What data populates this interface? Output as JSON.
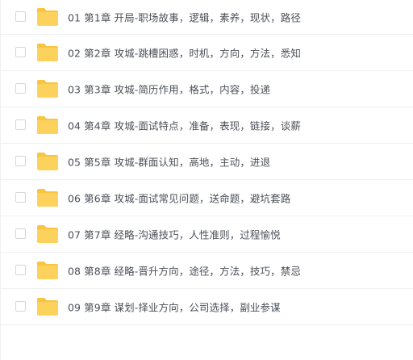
{
  "icons": {
    "folder": "folder-icon",
    "checkbox": "checkbox-unchecked",
    "folder_color": "#FDD25C",
    "folder_tab_color": "#F9C440"
  },
  "files": [
    {
      "name": "01 第1章 开局-职场故事，逻辑，素养，现状，路径"
    },
    {
      "name": "02 第2章 攻城-跳槽困惑，时机，方向，方法，悉知"
    },
    {
      "name": "03 第3章 攻城-简历作用，格式，内容，投递"
    },
    {
      "name": "04 第4章 攻城-面试特点，准备，表现，链接，谈薪"
    },
    {
      "name": "05 第5章 攻城-群面认知，高地，主动，进退"
    },
    {
      "name": "06 第6章 攻城-面试常见问题，送命题，避坑套路"
    },
    {
      "name": "07 第7章 经略-沟通技巧，人性准则，过程愉悦"
    },
    {
      "name": "08 第8章 经略-晋升方向，途径，方法，技巧，禁忌"
    },
    {
      "name": "09 第9章 谋划-择业方向，公司选择，副业参谋"
    }
  ]
}
